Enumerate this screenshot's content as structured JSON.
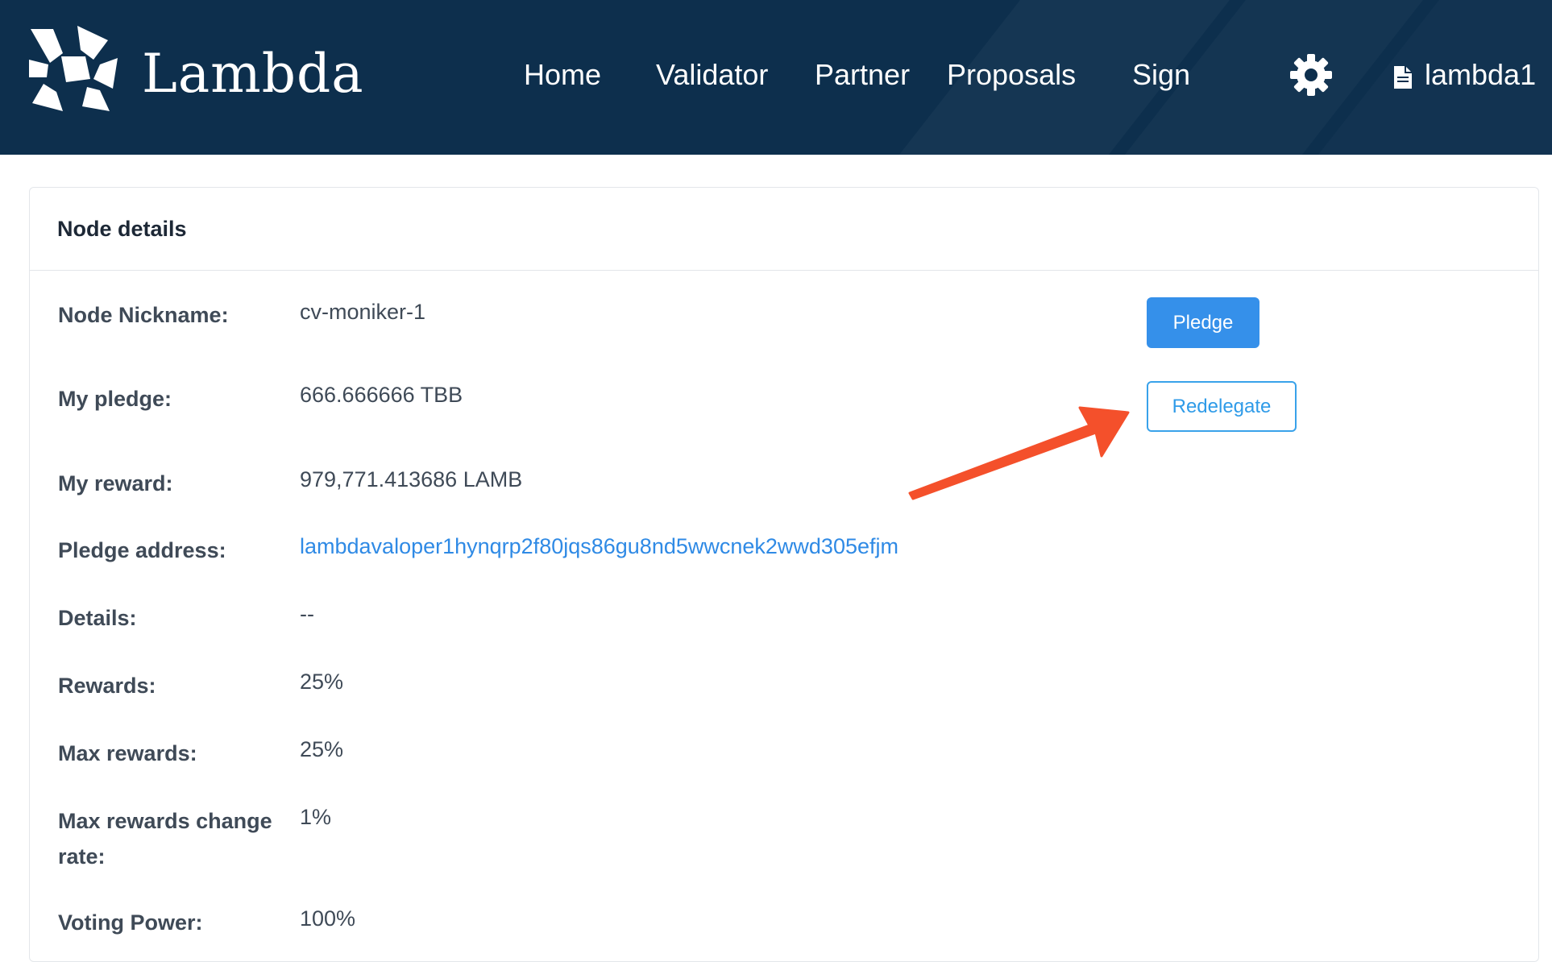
{
  "header": {
    "brand": "Lambda",
    "nav": [
      {
        "label": "Home"
      },
      {
        "label": "Validator"
      },
      {
        "label": "Partner"
      },
      {
        "label": "Proposals"
      },
      {
        "label": "Sign"
      }
    ],
    "settings_icon": "gear-icon",
    "account_icon": "document-icon",
    "account_label": "lambda1"
  },
  "card": {
    "title": "Node details",
    "rows": [
      {
        "label": "Node Nickname:",
        "value": "cv-moniker-1"
      },
      {
        "label": "My pledge:",
        "value": "666.666666 TBB"
      },
      {
        "label": "My reward:",
        "value": "979,771.413686 LAMB"
      },
      {
        "label": "Pledge address:",
        "value": "lambdavaloper1hynqrp2f80jqs86gu8nd5wwcnek2wwd305efjm"
      },
      {
        "label": "Details:",
        "value": "--"
      },
      {
        "label": "Rewards:",
        "value": "25%"
      },
      {
        "label": "Max rewards:",
        "value": "25%"
      },
      {
        "label": "Max rewards change rate:",
        "value": "1%"
      },
      {
        "label": "Voting Power:",
        "value": "100%"
      }
    ],
    "buttons": {
      "pledge": "Pledge",
      "redelegate": "Redelegate"
    }
  },
  "annotation": {
    "arrow_color": "#f4502b",
    "points_to": "Redelegate"
  },
  "colors": {
    "header_bg": "#0d2f4d",
    "primary": "#3590ea",
    "link": "#2f8ae5"
  }
}
